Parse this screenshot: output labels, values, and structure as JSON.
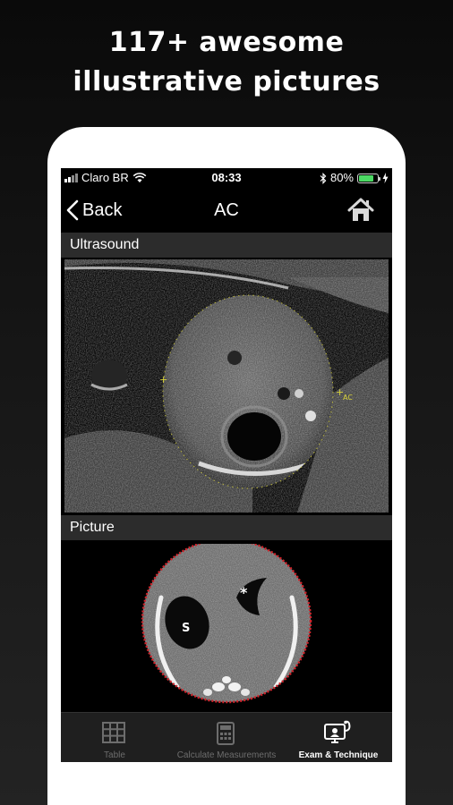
{
  "promo": {
    "headline_line1": "117+ awesome",
    "headline_line2": "illustrative pictures"
  },
  "status_bar": {
    "carrier": "Claro BR",
    "time": "08:33",
    "battery_percent": "80%",
    "battery_level": 0.8
  },
  "nav": {
    "back_label": "Back",
    "title": "AC",
    "home_icon": "home-icon"
  },
  "sections": {
    "ultrasound_title": "Ultrasound",
    "picture_title": "Picture"
  },
  "ultrasound": {
    "caliper_label": "AC"
  },
  "picture": {
    "stomach_label": "S",
    "marker_label": "*"
  },
  "tabs": [
    {
      "label": "Table",
      "icon": "table-icon",
      "active": false
    },
    {
      "label": "Calculate Measurements",
      "icon": "calculator-icon",
      "active": false
    },
    {
      "label": "Exam & Technique",
      "icon": "exam-monitor-icon",
      "active": true
    }
  ],
  "colors": {
    "tab_active": "#ffffff",
    "tab_inactive": "#6d6d6d",
    "section_header_bg": "#2c2c2c",
    "battery": "#4cd964",
    "picture_outline": "#d0242b",
    "caliper": "#d8d23a"
  }
}
